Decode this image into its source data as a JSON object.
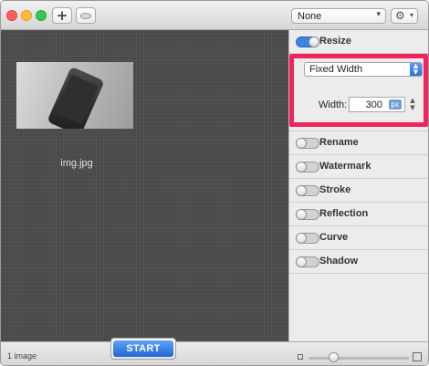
{
  "toolbar": {
    "add_icon": "plus-icon",
    "preview_icon": "eye-icon",
    "preset_value": "None",
    "gear_icon": "gear-icon"
  },
  "canvas": {
    "image_name": "img.jpg"
  },
  "panel": {
    "resize": {
      "label": "Resize",
      "enabled": true,
      "mode": "Fixed Width",
      "width_label": "Width:",
      "width_value": "300",
      "width_unit": "px"
    },
    "actions": [
      {
        "label": "Rename",
        "enabled": false
      },
      {
        "label": "Watermark",
        "enabled": false
      },
      {
        "label": "Stroke",
        "enabled": false
      },
      {
        "label": "Reflection",
        "enabled": false
      },
      {
        "label": "Curve",
        "enabled": false
      },
      {
        "label": "Shadow",
        "enabled": false
      }
    ]
  },
  "bottom": {
    "count_text": "1 image",
    "start_label": "START"
  },
  "colors": {
    "accent": "#2a6fe0",
    "highlight": "#f0245e",
    "canvas": "#4a4a4a"
  }
}
